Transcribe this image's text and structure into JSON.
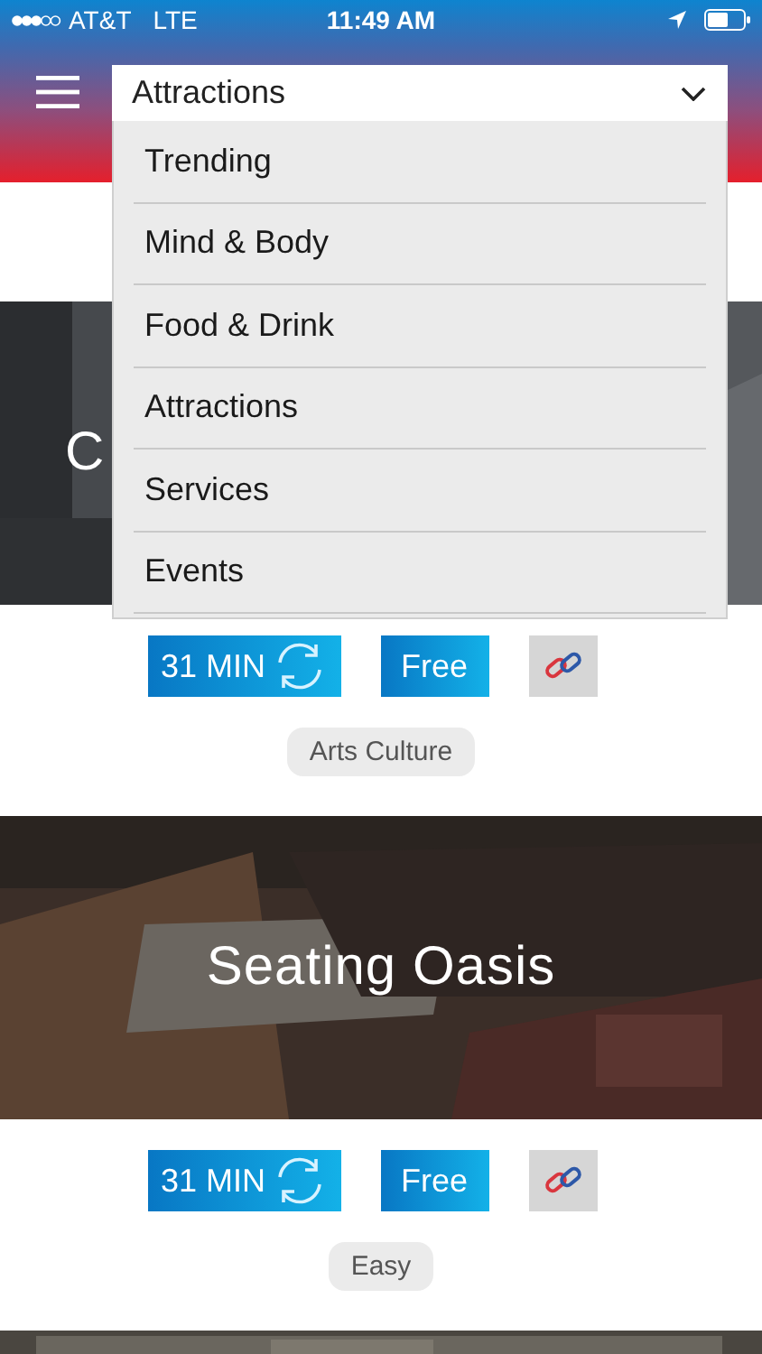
{
  "status_bar": {
    "carrier": "AT&T",
    "network": "LTE",
    "time": "11:49 AM"
  },
  "category_dropdown": {
    "value": "Attractions",
    "expanded": true,
    "options": [
      "Trending",
      "Mind & Body",
      "Food & Drink",
      "Attractions",
      "Services",
      "Events"
    ]
  },
  "cards": [
    {
      "title": "C",
      "duration": "31 MIN",
      "price": "Free",
      "tag": "Arts Culture"
    },
    {
      "title": "Seating Oasis",
      "duration": "31 MIN",
      "price": "Free",
      "tag": "Easy"
    }
  ]
}
